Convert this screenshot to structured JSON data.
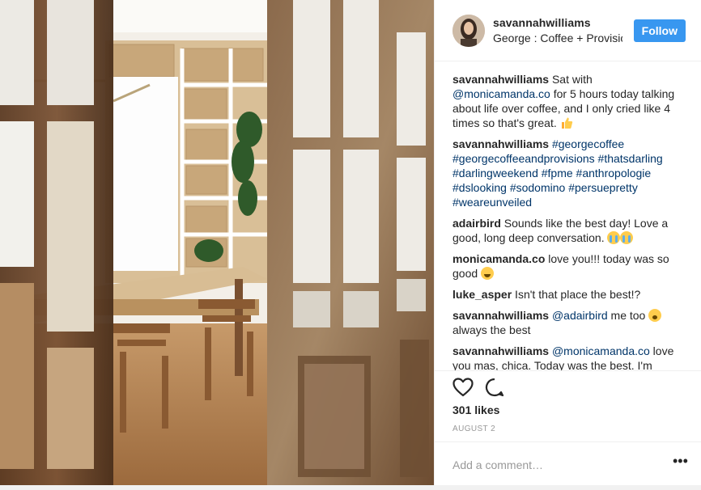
{
  "post": {
    "author": "savannahwilliams",
    "location": "George : Coffee + Provisions",
    "follow_label": "Follow",
    "likes": "301 likes",
    "date": "AUGUST 2",
    "add_comment_placeholder": "Add a comment…",
    "more_label": "•••"
  },
  "comments": [
    {
      "user": "savannahwilliams",
      "parts": [
        {
          "text": " Sat with "
        },
        {
          "link": "@monicamanda.co"
        },
        {
          "text": " for 5 hours today talking about life over coffee, and I only cried like 4 times so that's great. "
        }
      ],
      "emoji": "thumb"
    },
    {
      "user": "savannahwilliams",
      "parts": [
        {
          "text": " "
        },
        {
          "link": "#georgecoffee #georgecoffeeandprovisions #thatsdarling #darlingweekend #fpme #anthropologie #dslooking #sodomino #persuepretty #weareunveiled"
        }
      ],
      "emoji": ""
    },
    {
      "user": "adairbird",
      "parts": [
        {
          "text": " Sounds like the best day! Love a good, long deep conversation. "
        }
      ],
      "emoji": "cry2"
    },
    {
      "user": "monicamanda.co",
      "parts": [
        {
          "text": " love you!!! today was so good "
        }
      ],
      "emoji": "hug"
    },
    {
      "user": "luke_asper",
      "parts": [
        {
          "text": " Isn't that place the best!?"
        }
      ],
      "emoji": ""
    },
    {
      "user": "savannahwilliams",
      "parts": [
        {
          "text": " "
        },
        {
          "link": "@adairbird"
        },
        {
          "text": " me too "
        }
      ],
      "emoji": "weary",
      "tail": " always the best"
    },
    {
      "user": "savannahwilliams",
      "parts": [
        {
          "text": " "
        },
        {
          "link": "@monicamanda.co"
        },
        {
          "text": " love you mas, chica. Today was the best. I'm refueled "
        }
      ],
      "emoji": ""
    }
  ],
  "icons": {
    "like": "heart-icon",
    "comment": "comment-bubble-icon",
    "more": "more-options-icon"
  },
  "colors": {
    "follow_button": "#3897f0",
    "link": "#003569",
    "text": "#262626",
    "muted": "#999999"
  }
}
